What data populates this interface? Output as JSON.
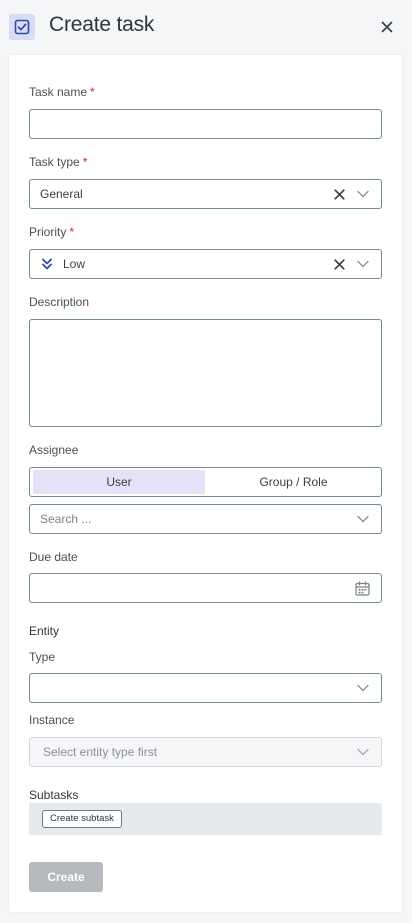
{
  "header": {
    "title": "Create task",
    "icon": "checkbox-icon",
    "close_icon": "close-icon"
  },
  "form": {
    "task_name": {
      "label": "Task name",
      "required_mark": "*",
      "value": ""
    },
    "task_type": {
      "label": "Task type",
      "required_mark": "*",
      "value": "General"
    },
    "priority": {
      "label": "Priority",
      "required_mark": "*",
      "value": "Low",
      "icon": "double-chevron-down-icon"
    },
    "description": {
      "label": "Description",
      "value": ""
    },
    "assignee": {
      "label": "Assignee",
      "options": [
        "User",
        "Group / Role"
      ],
      "selected": "User",
      "search_placeholder": "Search ..."
    },
    "due_date": {
      "label": "Due date",
      "value": ""
    }
  },
  "entity": {
    "title": "Entity",
    "type": {
      "label": "Type",
      "value": ""
    },
    "instance": {
      "label": "Instance",
      "placeholder": "Select entity type first"
    }
  },
  "subtasks": {
    "title": "Subtasks",
    "create_label": "Create subtask"
  },
  "actions": {
    "create_label": "Create"
  },
  "colors": {
    "accent": "#2d4aa8",
    "required": "#c8213a",
    "field_border": "#6e8b96",
    "selected_segment": "#e5e1f6",
    "disabled_button": "#b6b9bd"
  }
}
